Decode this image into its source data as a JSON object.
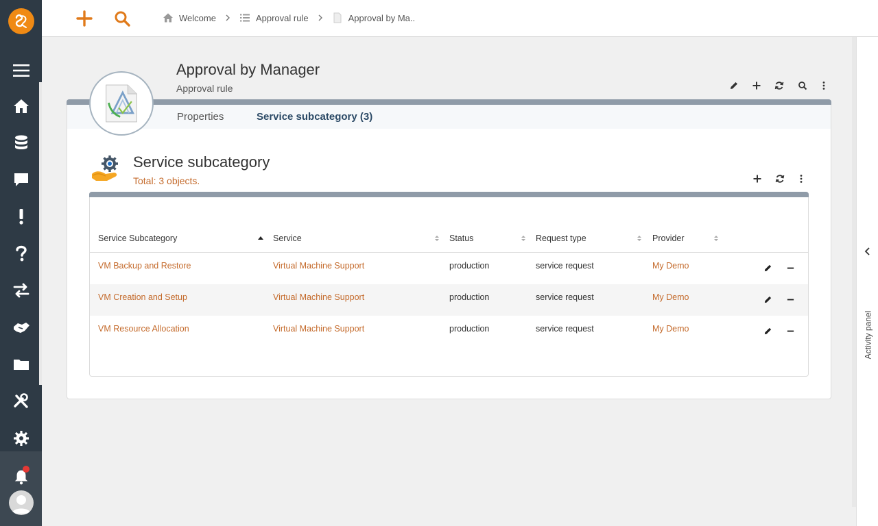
{
  "topbar": {
    "breadcrumbs": [
      {
        "label": "Welcome",
        "icon": "home-icon"
      },
      {
        "label": "Approval rule",
        "icon": "list-icon"
      },
      {
        "label": "Approval by Ma..",
        "icon": "document-icon"
      }
    ]
  },
  "entity": {
    "title": "Approval by Manager",
    "subtitle": "Approval rule"
  },
  "tabs": [
    {
      "label": "Properties"
    },
    {
      "label": "Service subcategory (3)"
    }
  ],
  "section": {
    "title": "Service subcategory",
    "total": "Total: 3 objects."
  },
  "table": {
    "columns": [
      "Service Subcategory",
      "Service",
      "Status",
      "Request type",
      "Provider"
    ],
    "rows": [
      {
        "subcategory": "VM Backup and Restore",
        "service": "Virtual Machine Support",
        "status": "production",
        "request_type": "service request",
        "provider": "My Demo"
      },
      {
        "subcategory": "VM Creation and Setup",
        "service": "Virtual Machine Support",
        "status": "production",
        "request_type": "service request",
        "provider": "My Demo"
      },
      {
        "subcategory": "VM Resource Allocation",
        "service": "Virtual Machine Support",
        "status": "production",
        "request_type": "service request",
        "provider": "My Demo"
      }
    ]
  },
  "activity_panel": {
    "label": "Activity panel"
  },
  "colors": {
    "accent": "#f08a14",
    "link": "#c46a2b",
    "sidebar": "#2e3a45",
    "tab_active": "#2c4a66"
  }
}
